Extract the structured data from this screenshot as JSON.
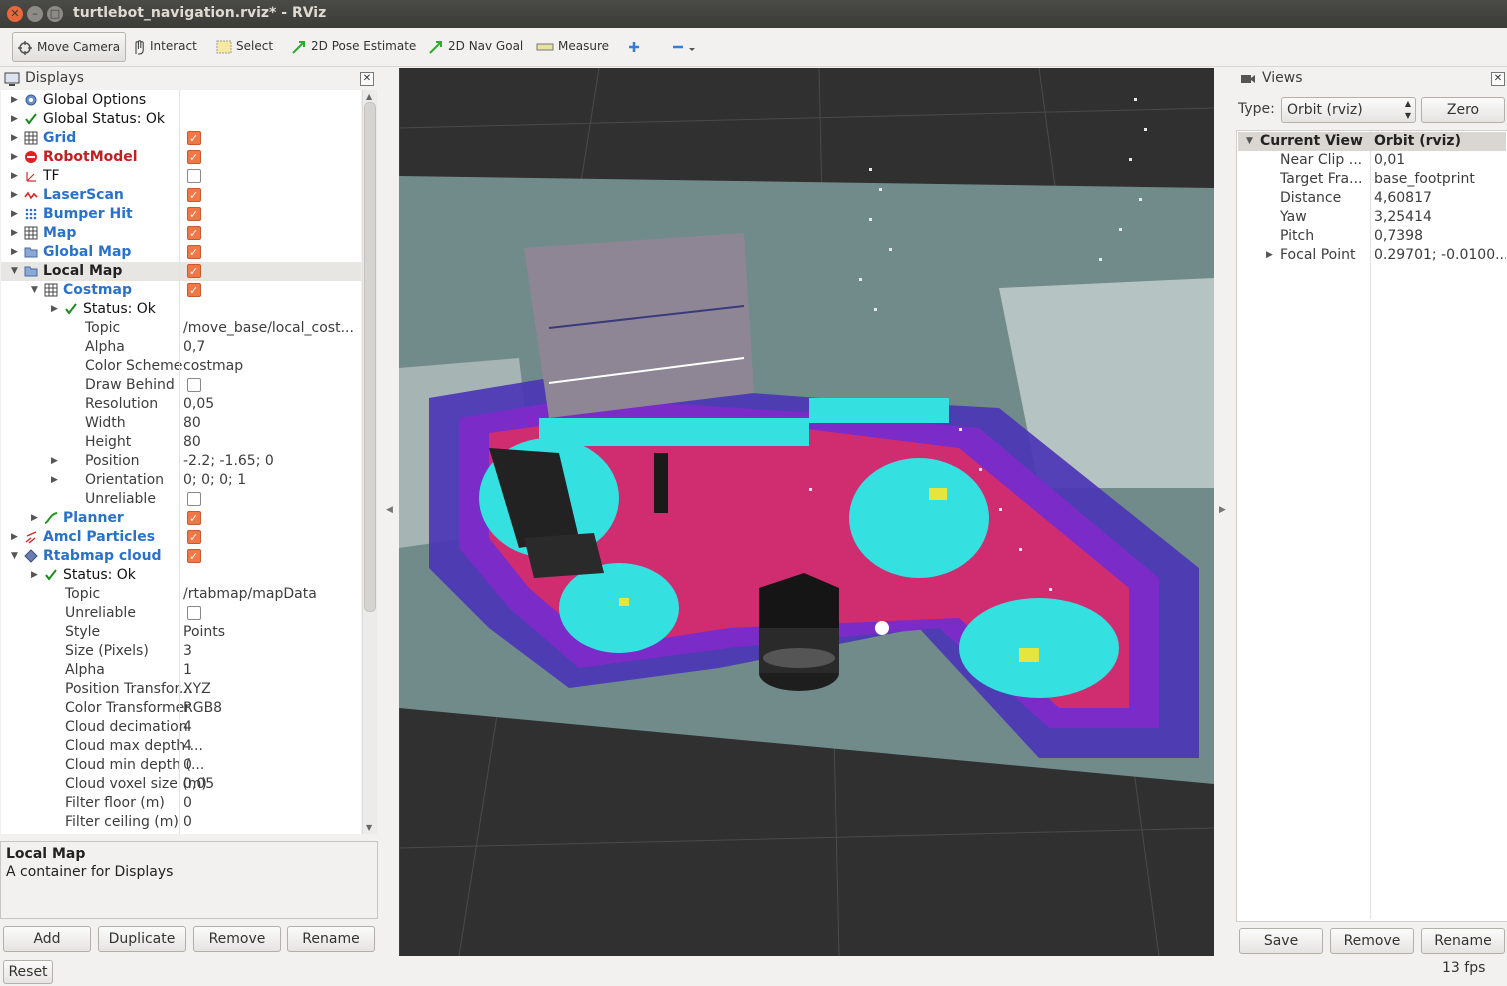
{
  "window": {
    "title": "turtlebot_navigation.rviz* - RViz"
  },
  "toolbar": {
    "move_camera": "Move Camera",
    "interact": "Interact",
    "select": "Select",
    "pose_estimate": "2D Pose Estimate",
    "nav_goal": "2D Nav Goal",
    "measure": "Measure"
  },
  "displays": {
    "title": "Displays",
    "rows": [
      {
        "label": "Global Options",
        "value": "",
        "check": null
      },
      {
        "label": "Global Status: Ok",
        "value": "",
        "check": null
      },
      {
        "label": "Grid",
        "value": "",
        "check": true
      },
      {
        "label": "RobotModel",
        "value": "",
        "check": true
      },
      {
        "label": "TF",
        "value": "",
        "check": false
      },
      {
        "label": "LaserScan",
        "value": "",
        "check": true
      },
      {
        "label": "Bumper Hit",
        "value": "",
        "check": true
      },
      {
        "label": "Map",
        "value": "",
        "check": true
      },
      {
        "label": "Global Map",
        "value": "",
        "check": true
      },
      {
        "label": "Local Map",
        "value": "",
        "check": true
      },
      {
        "label": "Costmap",
        "value": "",
        "check": true
      },
      {
        "label": "Status: Ok",
        "value": "",
        "check": null
      },
      {
        "label": "Topic",
        "value": "/move_base/local_cost...",
        "check": null
      },
      {
        "label": "Alpha",
        "value": "0,7",
        "check": null
      },
      {
        "label": "Color Scheme",
        "value": "costmap",
        "check": null
      },
      {
        "label": "Draw Behind",
        "value": "",
        "check": false
      },
      {
        "label": "Resolution",
        "value": "0,05",
        "check": null
      },
      {
        "label": "Width",
        "value": "80",
        "check": null
      },
      {
        "label": "Height",
        "value": "80",
        "check": null
      },
      {
        "label": "Position",
        "value": "-2.2; -1.65; 0",
        "check": null
      },
      {
        "label": "Orientation",
        "value": "0; 0; 0; 1",
        "check": null
      },
      {
        "label": "Unreliable",
        "value": "",
        "check": false
      },
      {
        "label": "Planner",
        "value": "",
        "check": true
      },
      {
        "label": "Amcl Particles",
        "value": "",
        "check": true
      },
      {
        "label": "Rtabmap cloud",
        "value": "",
        "check": true
      },
      {
        "label": "Status: Ok",
        "value": "",
        "check": null
      },
      {
        "label": "Topic",
        "value": "/rtabmap/mapData",
        "check": null
      },
      {
        "label": "Unreliable",
        "value": "",
        "check": false
      },
      {
        "label": "Style",
        "value": "Points",
        "check": null
      },
      {
        "label": "Size (Pixels)",
        "value": "3",
        "check": null
      },
      {
        "label": "Alpha",
        "value": "1",
        "check": null
      },
      {
        "label": "Position Transfor...",
        "value": "XYZ",
        "check": null
      },
      {
        "label": "Color Transformer",
        "value": "RGB8",
        "check": null
      },
      {
        "label": "Cloud decimation",
        "value": "4",
        "check": null
      },
      {
        "label": "Cloud max depth ...",
        "value": "4",
        "check": null
      },
      {
        "label": "Cloud min depth (...",
        "value": "0",
        "check": null
      },
      {
        "label": "Cloud voxel size (m)",
        "value": "0,05",
        "check": null
      },
      {
        "label": "Filter floor (m)",
        "value": "0",
        "check": null
      },
      {
        "label": "Filter ceiling (m)",
        "value": "0",
        "check": null
      }
    ],
    "description_title": "Local Map",
    "description_text": "A container for Displays",
    "buttons": {
      "add": "Add",
      "duplicate": "Duplicate",
      "remove": "Remove",
      "rename": "Rename"
    }
  },
  "views": {
    "title": "Views",
    "type_label": "Type:",
    "type_value": "Orbit (rviz)",
    "zero_label": "Zero",
    "header_key": "Current View",
    "header_value": "Orbit (rviz)",
    "rows": [
      {
        "key": "Near Clip ...",
        "value": "0,01"
      },
      {
        "key": "Target Fra...",
        "value": "base_footprint"
      },
      {
        "key": "Distance",
        "value": "4,60817"
      },
      {
        "key": "Yaw",
        "value": "3,25414"
      },
      {
        "key": "Pitch",
        "value": "0,7398"
      },
      {
        "key": "Focal Point",
        "value": "0.29701; -0.0100..."
      }
    ],
    "buttons": {
      "save": "Save",
      "remove": "Remove",
      "rename": "Rename"
    }
  },
  "status": {
    "reset": "Reset",
    "fps": "13 fps"
  }
}
